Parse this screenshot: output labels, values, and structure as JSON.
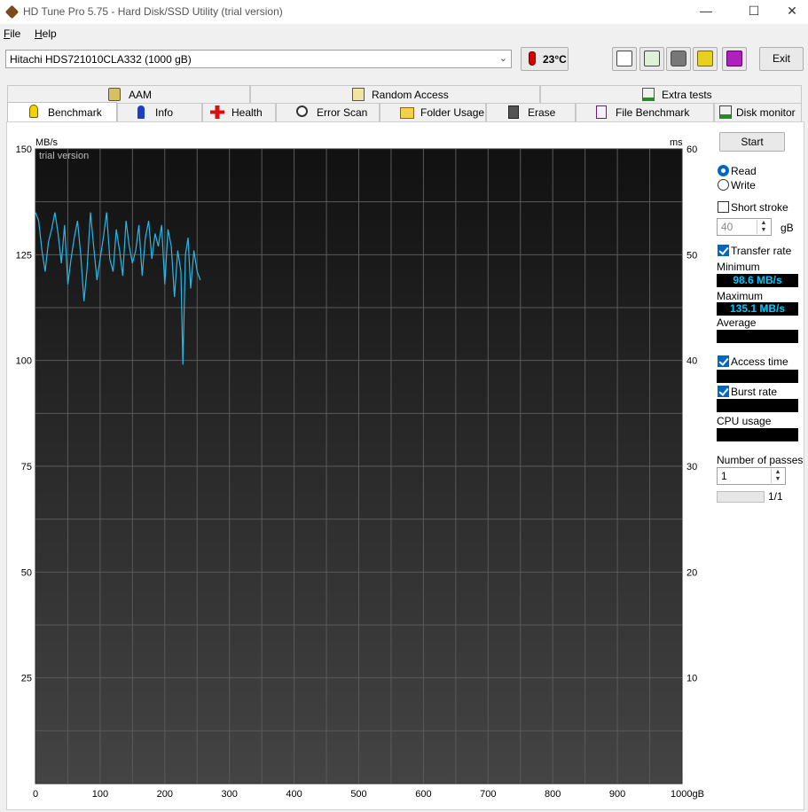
{
  "window": {
    "title": "HD Tune Pro 5.75 - Hard Disk/SSD Utility (trial version)"
  },
  "menu": [
    {
      "label": "File",
      "accel": "F",
      "rest": "ile"
    },
    {
      "label": "Help",
      "accel": "H",
      "rest": "elp"
    }
  ],
  "toolbar": {
    "drive": "Hitachi HDS721010CLA332 (1000 gB)",
    "temperature": "23°C",
    "exit_label": "Exit",
    "icons": [
      "copy-text-icon",
      "copy-screen-icon",
      "camera-icon",
      "wrench-icon",
      "save-icon"
    ]
  },
  "tabs_row1": [
    {
      "label": "AAM",
      "icon": "speaker-icon"
    },
    {
      "label": "Random Access",
      "icon": "random-access-icon"
    },
    {
      "label": "Extra tests",
      "icon": "extra-tests-icon"
    }
  ],
  "tabs_row2": [
    {
      "label": "Benchmark",
      "icon": "benchmark-bulb-icon",
      "active": true
    },
    {
      "label": "Info",
      "icon": "info-icon"
    },
    {
      "label": "Health",
      "icon": "health-cross-icon"
    },
    {
      "label": "Error Scan",
      "icon": "magnifier-icon"
    },
    {
      "label": "Folder Usage",
      "icon": "folder-icon"
    },
    {
      "label": "Erase",
      "icon": "trash-icon"
    },
    {
      "label": "File Benchmark",
      "icon": "file-benchmark-icon"
    },
    {
      "label": "Disk monitor",
      "icon": "disk-monitor-icon"
    }
  ],
  "side": {
    "start_label": "Start",
    "read_label": "Read",
    "write_label": "Write",
    "short_stroke_label": "Short stroke",
    "short_stroke_value": "40",
    "short_stroke_unit": "gB",
    "transfer_rate_label": "Transfer rate",
    "minimum_label": "Minimum",
    "minimum_value": "98.6 MB/s",
    "maximum_label": "Maximum",
    "maximum_value": "135.1 MB/s",
    "average_label": "Average",
    "access_time_label": "Access time",
    "burst_rate_label": "Burst rate",
    "cpu_usage_label": "CPU usage",
    "passes_label": "Number of passes",
    "passes_value": "1",
    "pass_progress": "1/1"
  },
  "chart_data": {
    "type": "line",
    "watermark": "trial version",
    "ylabel_left": "MB/s",
    "ylabel_right": "ms",
    "xlabel": "gB",
    "xlim": [
      0,
      1000
    ],
    "ylim_left": [
      0,
      150
    ],
    "ylim_right": [
      0,
      60
    ],
    "x_ticks": [
      "0",
      "100",
      "200",
      "300",
      "400",
      "500",
      "600",
      "700",
      "800",
      "900",
      "1000gB"
    ],
    "y_ticks_left": [
      "150",
      "125",
      "100",
      "75",
      "50",
      "25"
    ],
    "y_ticks_right": [
      "60",
      "50",
      "40",
      "30",
      "20",
      "10"
    ],
    "grid": true,
    "series": [
      {
        "color": "#2ab7e6",
        "x": [
          0,
          5,
          10,
          15,
          20,
          25,
          30,
          35,
          40,
          45,
          50,
          55,
          60,
          65,
          70,
          75,
          80,
          85,
          90,
          95,
          100,
          105,
          110,
          115,
          120,
          125,
          130,
          135,
          140,
          145,
          150,
          155,
          160,
          165,
          170,
          175,
          180,
          185,
          190,
          195,
          200,
          205,
          210,
          215,
          220,
          225,
          228,
          232,
          236,
          240,
          245,
          250,
          255
        ],
        "y": [
          135,
          133,
          126,
          121,
          128,
          131,
          135,
          130,
          123,
          132,
          118,
          124,
          129,
          133,
          125,
          114,
          122,
          135,
          127,
          119,
          124,
          129,
          135,
          124,
          121,
          131,
          126,
          120,
          133,
          127,
          123,
          126,
          132,
          120,
          129,
          133,
          124,
          130,
          127,
          132,
          118,
          131,
          127,
          115,
          126,
          121,
          99,
          125,
          129,
          117,
          126,
          121,
          119
        ]
      }
    ]
  },
  "colors": {
    "chart_bg_top": "#111111",
    "chart_bg_bottom": "#444444",
    "grid": "#5a5a5a",
    "line": "#2ab7e6",
    "value_text": "#00c8ff"
  }
}
